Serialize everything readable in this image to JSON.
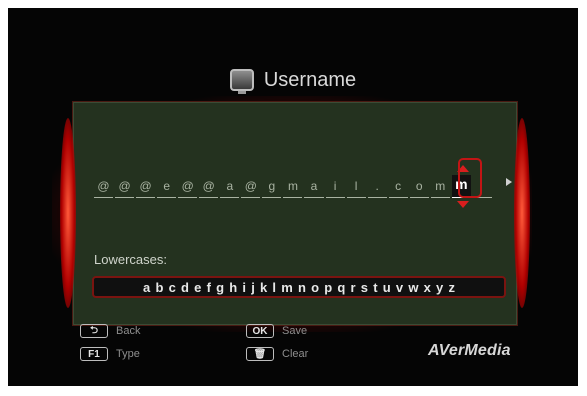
{
  "title": {
    "text": "Username",
    "icon": "monitor-icon"
  },
  "username_field": {
    "chars": [
      "@",
      "@",
      "@",
      "e",
      "@",
      "@",
      "a",
      "@",
      "g",
      "m",
      "a",
      "i",
      "l",
      ".",
      "c",
      "o",
      "m"
    ],
    "active_char": "m",
    "next_arrow_icon": "chevron-right-icon"
  },
  "keyboard": {
    "label": "Lowercases:",
    "letters": [
      "a",
      "b",
      "c",
      "d",
      "e",
      "f",
      "g",
      "h",
      "i",
      "j",
      "k",
      "l",
      "m",
      "n",
      "o",
      "p",
      "q",
      "r",
      "s",
      "t",
      "u",
      "v",
      "w",
      "x",
      "y",
      "z"
    ]
  },
  "hints": {
    "back": {
      "key": "⮌",
      "label": "Back"
    },
    "type": {
      "key": "F1",
      "label": "Type"
    },
    "save": {
      "key": "OK",
      "label": "Save"
    },
    "clear": {
      "key": "🗑",
      "label": "Clear"
    }
  },
  "brand": "AVerMedia",
  "colors": {
    "panel_bg": "#24321f",
    "accent_red": "#c21515",
    "background": "#050505"
  }
}
